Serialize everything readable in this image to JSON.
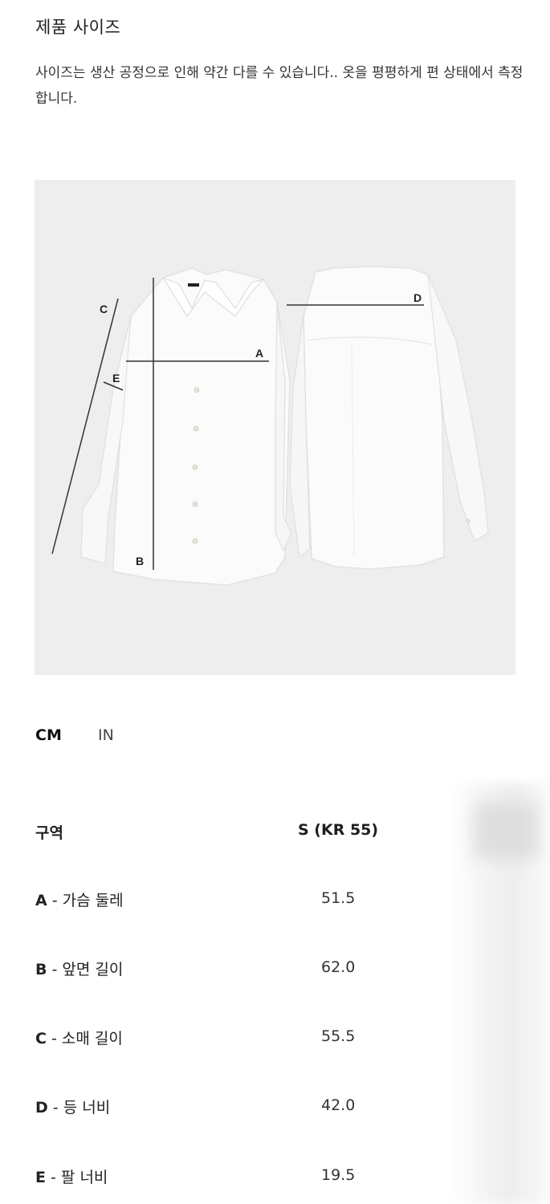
{
  "header": {
    "title": "제품 사이즈",
    "description": "사이즈는 생산 공정으로 인해 약간 다를 수 있습니다.. 옷을 평평하게 편 상태에서 측정합니다."
  },
  "diagram": {
    "labels": {
      "a": "A",
      "b": "B",
      "c": "C",
      "d": "D",
      "e": "E"
    }
  },
  "units": {
    "cm": "CM",
    "in": "IN",
    "selected": "CM"
  },
  "table": {
    "col_label": "구역",
    "col_size": "S (KR 55)",
    "rows": [
      {
        "key": "A",
        "label": " - 가슴 둘레",
        "value": "51.5"
      },
      {
        "key": "B",
        "label": " - 앞면 길이",
        "value": "62.0"
      },
      {
        "key": "C",
        "label": " - 소매 길이",
        "value": "55.5"
      },
      {
        "key": "D",
        "label": " - 등 너비",
        "value": "42.0"
      },
      {
        "key": "E",
        "label": " - 팔 너비",
        "value": "19.5"
      }
    ]
  },
  "colors": {
    "figure_bg": "#eeeeef",
    "measure_line": "#333333"
  }
}
